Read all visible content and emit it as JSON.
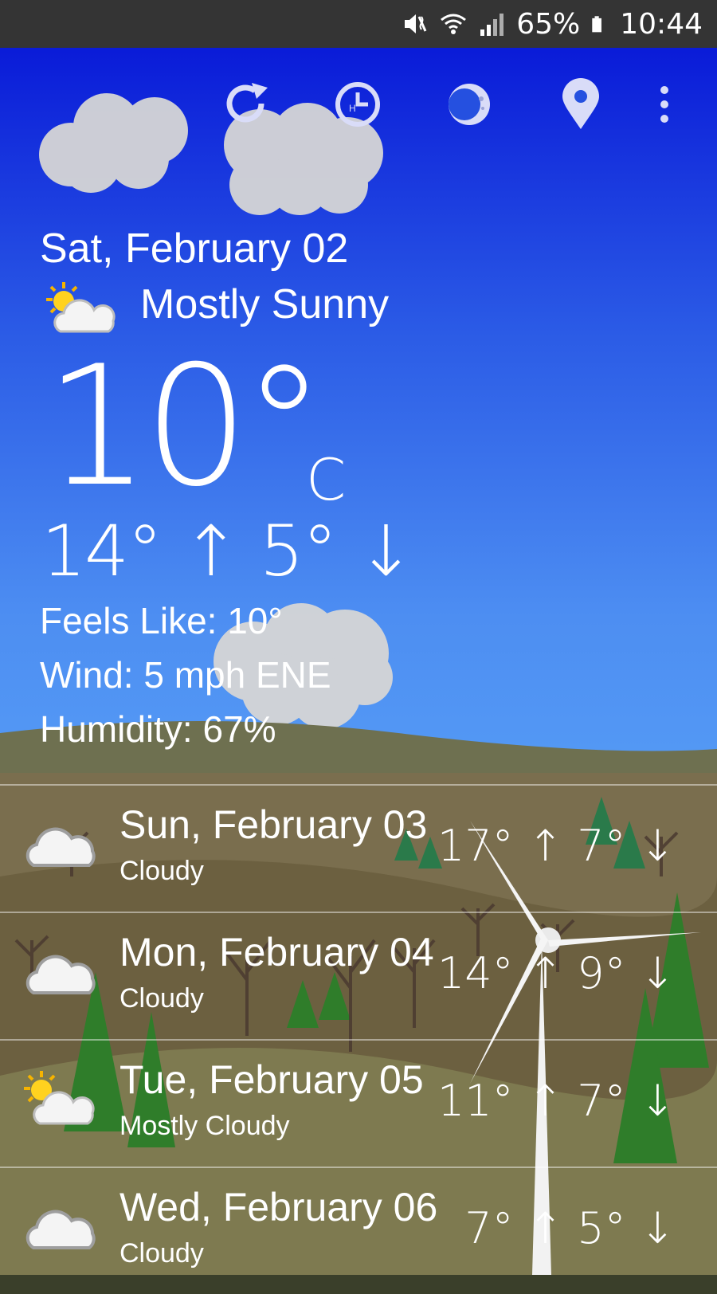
{
  "status_bar": {
    "battery_percent": "65%",
    "time": "10:44",
    "icons": [
      "mute-vibrate-icon",
      "wifi-icon",
      "cell-signal-icon",
      "battery-icon"
    ]
  },
  "toolbar": {
    "icons": [
      "refresh-icon",
      "history-icon",
      "moon-phase-icon",
      "location-pin-icon",
      "more-vert-icon"
    ]
  },
  "current": {
    "date": "Sat, February 02",
    "condition": "Mostly Sunny",
    "condition_icon": "partly-sunny-icon",
    "temperature": "10°",
    "unit": "C",
    "range": "14° ↑ 5° ↓",
    "feels_like": "Feels Like: 10°",
    "wind": "Wind: 5 mph ENE",
    "humidity": "Humidity: 67%"
  },
  "forecast": [
    {
      "day": "Sun, February 03",
      "condition": "Cloudy",
      "icon": "cloudy-icon",
      "range": "17° ↑ 7° ↓"
    },
    {
      "day": "Mon, February 04",
      "condition": "Cloudy",
      "icon": "cloudy-icon",
      "range": "14° ↑ 9° ↓"
    },
    {
      "day": "Tue, February 05",
      "condition": "Mostly Cloudy",
      "icon": "partly-sunny-icon",
      "range": "11° ↑ 7° ↓"
    },
    {
      "day": "Wed, February 06",
      "condition": "Cloudy",
      "icon": "cloudy-icon",
      "range": "7° ↑ 5° ↓"
    }
  ],
  "colors": {
    "status_bar": "#343434",
    "sky_top": "#0a1bd8",
    "sky_bottom": "#58a0f6",
    "hill": "#6b6a4a",
    "tree_green": "#2f7d2a"
  }
}
